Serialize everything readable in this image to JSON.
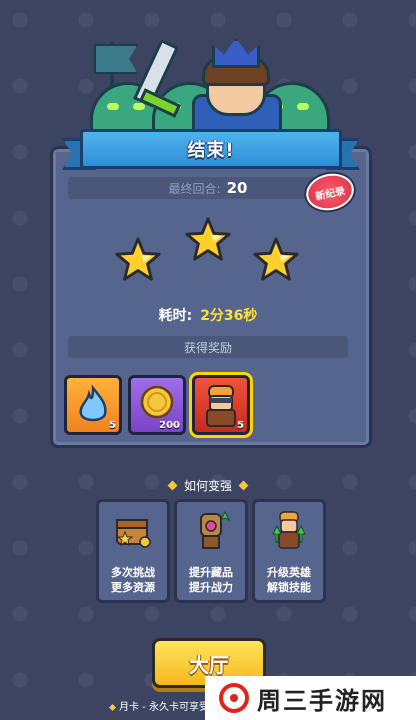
{
  "result": {
    "title": "结束!",
    "round_label": "最终回合:",
    "round_value": "20",
    "record_badge": "新纪录",
    "stars": 3,
    "time_label": "耗时:",
    "time_value": "2分36秒",
    "rewards_label": "获得奖励"
  },
  "rewards": [
    {
      "icon": "blue-flame-icon",
      "count": "5"
    },
    {
      "icon": "gold-coin-icon",
      "count": "200"
    },
    {
      "icon": "hero-portrait-icon",
      "count": "5"
    }
  ],
  "howto": {
    "title": "如何变强",
    "tips": [
      {
        "icon": "treasure-chest-icon",
        "line1": "多次挑战",
        "line2": "更多资源"
      },
      {
        "icon": "gauntlet-icon",
        "line1": "提升藏品",
        "line2": "提升战力"
      },
      {
        "icon": "hero-upgrade-icon",
        "line1": "升级英雄",
        "line2": "解锁技能"
      }
    ]
  },
  "buttons": {
    "hall": "大厅"
  },
  "footer": {
    "text": "月卡 - 永久卡可享受免"
  },
  "watermark": {
    "text": "周三手游网"
  },
  "colors": {
    "background": "#3d4461",
    "panel": "#55658e",
    "banner": "#3fa3e6",
    "gold": "#f5c640",
    "accent_red": "#d83246"
  }
}
